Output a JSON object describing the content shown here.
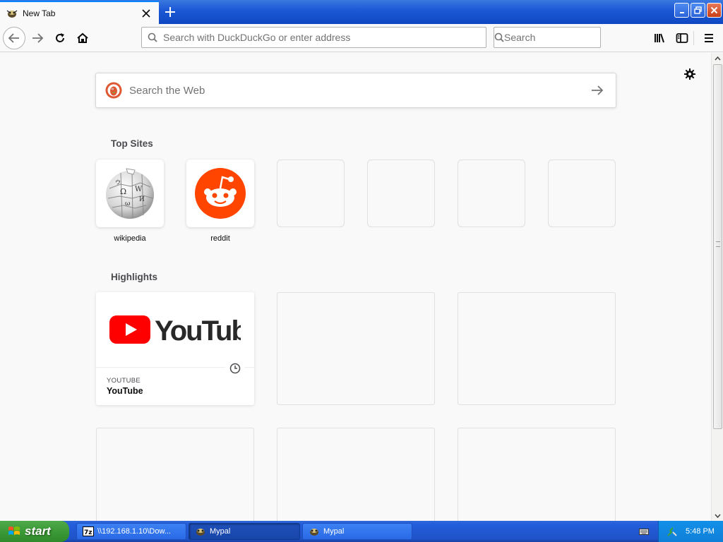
{
  "window": {
    "tab_title": "New Tab",
    "tab_favicon": "mypal-icon",
    "controls": [
      "minimize-icon",
      "restore-icon",
      "close-icon"
    ]
  },
  "toolbar": {
    "urlbar_placeholder": "Search with DuckDuckGo or enter address",
    "searchbar_placeholder": "Search",
    "icons": [
      "back-arrow-icon",
      "forward-arrow-icon",
      "reload-icon",
      "home-icon",
      "library-icon",
      "sidebar-icon",
      "hamburger-menu-icon"
    ]
  },
  "newtab": {
    "websearch_placeholder": "Search the Web",
    "topsites_title": "Top Sites",
    "highlights_title": "Highlights",
    "topsites": [
      {
        "label": "wikipedia",
        "icon": "wikipedia-globe-icon"
      },
      {
        "label": "reddit",
        "icon": "reddit-alien-icon"
      },
      {
        "label": ""
      },
      {
        "label": ""
      },
      {
        "label": ""
      },
      {
        "label": ""
      }
    ],
    "highlight": {
      "hostname": "YOUTUBE",
      "title": "YouTube",
      "logo_text": "YouTube",
      "badge_icon": "clock-icon"
    }
  },
  "taskbar": {
    "start_label": "start",
    "items": [
      {
        "label": "\\\\192.168.1.10\\Dow...",
        "icon": "7zip-icon",
        "active": false
      },
      {
        "label": "Mypal",
        "icon": "mypal-icon",
        "active": true
      },
      {
        "label": "Mypal",
        "icon": "mypal-icon",
        "active": false
      }
    ],
    "clock": "5:48 PM"
  },
  "colors": {
    "accent": "#0a84ff",
    "reddit": "#ff4500",
    "youtube_red": "#ff0000",
    "xp_blue": "#245edc",
    "xp_green": "#3c9a37"
  }
}
